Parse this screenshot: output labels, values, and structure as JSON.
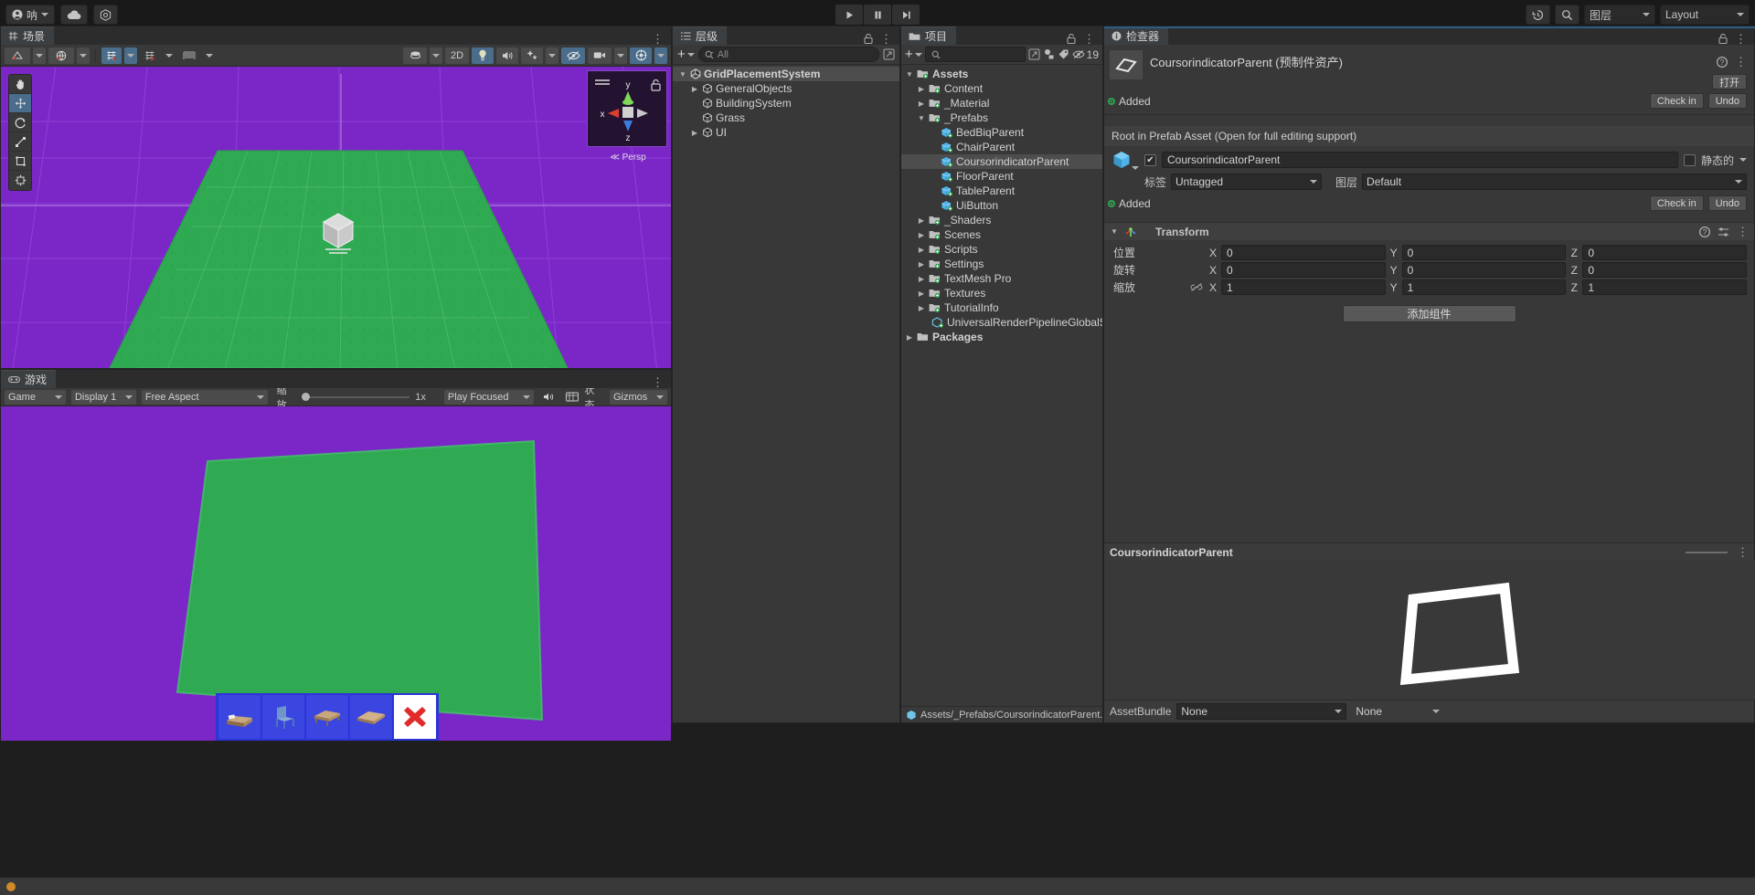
{
  "topbar": {
    "account_label": "呐",
    "cloud_icon": "cloud-icon",
    "services_icon": "services-icon",
    "play_icon": "play-icon",
    "pause_icon": "pause-icon",
    "step_icon": "step-icon",
    "history_icon": "history-icon",
    "search_icon": "search-icon",
    "layers_label": "图层",
    "layout_label": "Layout"
  },
  "scene": {
    "tab_label": "场景",
    "tab_icon": "grid-icon",
    "toolbar": {
      "shading_icon": "shading-mode-icon",
      "twod_label": "2D",
      "light_icon": "lighting-icon",
      "audio_icon": "audio-icon",
      "fx_icon": "effects-icon",
      "hidden_icon": "hidden-objects-icon",
      "camera_icon": "scene-camera-icon",
      "gizmos_icon": "gizmos-icon",
      "grid_icon": "grid-snap-icon",
      "snap_icon": "snap-increment-icon",
      "rulers_icon": "rulers-icon"
    },
    "tools": [
      "hand-tool",
      "move-tool",
      "rotate-tool",
      "scale-tool",
      "rect-tool",
      "transform-tool"
    ],
    "gizmo": {
      "x": "x",
      "y": "y",
      "z": "z",
      "persp": "Persp"
    }
  },
  "game": {
    "tab_label": "游戏",
    "display_label": "Display 1",
    "aspect_label": "Free Aspect",
    "scale_label": "缩放",
    "scale_value": "1x",
    "play_focus_label": "Play Focused",
    "mute_icon": "mute-audio-icon",
    "stats_label": "状态",
    "gizmos_label": "Gizmos",
    "view_tab": "Game",
    "ui_buttons": [
      "bed-icon",
      "chair-icon",
      "table-icon",
      "floor-icon",
      "cancel-icon"
    ]
  },
  "hierarchy": {
    "tab_label": "层级",
    "add_label": "+",
    "search_placeholder": "All",
    "items": [
      {
        "label": "GridPlacementSystem",
        "depth": 0,
        "expandable": true,
        "expanded": true,
        "selected": true,
        "bold": true,
        "icon": "unity-scene-icon"
      },
      {
        "label": "GeneralObjects",
        "depth": 1,
        "expandable": true,
        "expanded": false,
        "selected": false,
        "bold": false,
        "icon": "gameobject-icon"
      },
      {
        "label": "BuildingSystem",
        "depth": 1,
        "expandable": false,
        "expanded": false,
        "selected": false,
        "bold": false,
        "icon": "gameobject-icon"
      },
      {
        "label": "Grass",
        "depth": 1,
        "expandable": false,
        "expanded": false,
        "selected": false,
        "bold": false,
        "icon": "gameobject-icon"
      },
      {
        "label": "UI",
        "depth": 1,
        "expandable": true,
        "expanded": false,
        "selected": false,
        "bold": false,
        "icon": "gameobject-icon"
      }
    ]
  },
  "project": {
    "tab_label": "项目",
    "add_label": "+",
    "search_placeholder": "",
    "filter_icon": "asset-filter-icon",
    "label_icon": "label-filter-icon",
    "hidden_count": "19",
    "items": [
      {
        "label": "Assets",
        "depth": 0,
        "expandable": true,
        "expanded": true,
        "selected": false,
        "bold": true,
        "icon": "folder-icon"
      },
      {
        "label": "Content",
        "depth": 1,
        "expandable": true,
        "expanded": false,
        "selected": false,
        "bold": false,
        "icon": "folder-icon"
      },
      {
        "label": "_Material",
        "depth": 1,
        "expandable": true,
        "expanded": false,
        "selected": false,
        "bold": false,
        "icon": "folder-icon"
      },
      {
        "label": "_Prefabs",
        "depth": 1,
        "expandable": true,
        "expanded": true,
        "selected": false,
        "bold": false,
        "icon": "folder-icon"
      },
      {
        "label": "BedBiqParent",
        "depth": 2,
        "expandable": false,
        "expanded": false,
        "selected": false,
        "bold": false,
        "icon": "prefab-icon"
      },
      {
        "label": "ChairParent",
        "depth": 2,
        "expandable": false,
        "expanded": false,
        "selected": false,
        "bold": false,
        "icon": "prefab-icon"
      },
      {
        "label": "CoursorindicatorParent",
        "depth": 2,
        "expandable": false,
        "expanded": false,
        "selected": true,
        "bold": false,
        "icon": "prefab-icon"
      },
      {
        "label": "FloorParent",
        "depth": 2,
        "expandable": false,
        "expanded": false,
        "selected": false,
        "bold": false,
        "icon": "prefab-icon"
      },
      {
        "label": "TableParent",
        "depth": 2,
        "expandable": false,
        "expanded": false,
        "selected": false,
        "bold": false,
        "icon": "prefab-icon"
      },
      {
        "label": "UiButton",
        "depth": 2,
        "expandable": false,
        "expanded": false,
        "selected": false,
        "bold": false,
        "icon": "prefab-icon"
      },
      {
        "label": "_Shaders",
        "depth": 1,
        "expandable": true,
        "expanded": false,
        "selected": false,
        "bold": false,
        "icon": "folder-icon"
      },
      {
        "label": "Scenes",
        "depth": 1,
        "expandable": true,
        "expanded": false,
        "selected": false,
        "bold": false,
        "icon": "folder-icon"
      },
      {
        "label": "Scripts",
        "depth": 1,
        "expandable": true,
        "expanded": false,
        "selected": false,
        "bold": false,
        "icon": "folder-icon"
      },
      {
        "label": "Settings",
        "depth": 1,
        "expandable": true,
        "expanded": false,
        "selected": false,
        "bold": false,
        "icon": "folder-icon"
      },
      {
        "label": "TextMesh Pro",
        "depth": 1,
        "expandable": true,
        "expanded": false,
        "selected": false,
        "bold": false,
        "icon": "folder-icon"
      },
      {
        "label": "Textures",
        "depth": 1,
        "expandable": true,
        "expanded": false,
        "selected": false,
        "bold": false,
        "icon": "folder-icon"
      },
      {
        "label": "TutorialInfo",
        "depth": 1,
        "expandable": true,
        "expanded": false,
        "selected": false,
        "bold": false,
        "icon": "folder-icon"
      },
      {
        "label": "UniversalRenderPipelineGlobalSettings",
        "depth": 2,
        "expandable": false,
        "expanded": false,
        "selected": false,
        "bold": false,
        "icon": "asset-icon"
      },
      {
        "label": "Packages",
        "depth": 0,
        "expandable": true,
        "expanded": false,
        "selected": false,
        "bold": true,
        "icon": "folder-plain-icon"
      }
    ],
    "footer_path": "Assets/_Prefabs/CoursorindicatorParent.pre"
  },
  "inspector": {
    "tab_label": "检查器",
    "asset_title": "CoursorindicatorParent (预制件资产)",
    "open_label": "打开",
    "added_label": "Added",
    "checkin_label": "Check in",
    "undo_label": "Undo",
    "prefab_note": "Root in Prefab Asset (Open for full editing support)",
    "object_name": "CoursorindicatorParent",
    "static_label": "静态的",
    "tag_label": "标签",
    "tag_value": "Untagged",
    "layer_label": "图层",
    "layer_value": "Default",
    "transform": {
      "title": "Transform",
      "rows": [
        {
          "label": "位置",
          "x": "0",
          "y": "0",
          "z": "0"
        },
        {
          "label": "旋转",
          "x": "0",
          "y": "0",
          "z": "0"
        },
        {
          "label": "缩放",
          "x": "1",
          "y": "1",
          "z": "1"
        }
      ],
      "axis_x": "X",
      "axis_y": "Y",
      "axis_z": "Z"
    },
    "add_component_label": "添加组件",
    "preview_title": "CoursorindicatorParent",
    "assetbundle_label": "AssetBundle",
    "assetbundle_value": "None",
    "assetbundle_variant": "None"
  },
  "colors": {
    "accent": "#2c5d87",
    "added_green": "#2ea44f",
    "scene_bg": "#7b27c8",
    "grass_green": "#2faa53",
    "ui_blue": "#2b35d8"
  }
}
